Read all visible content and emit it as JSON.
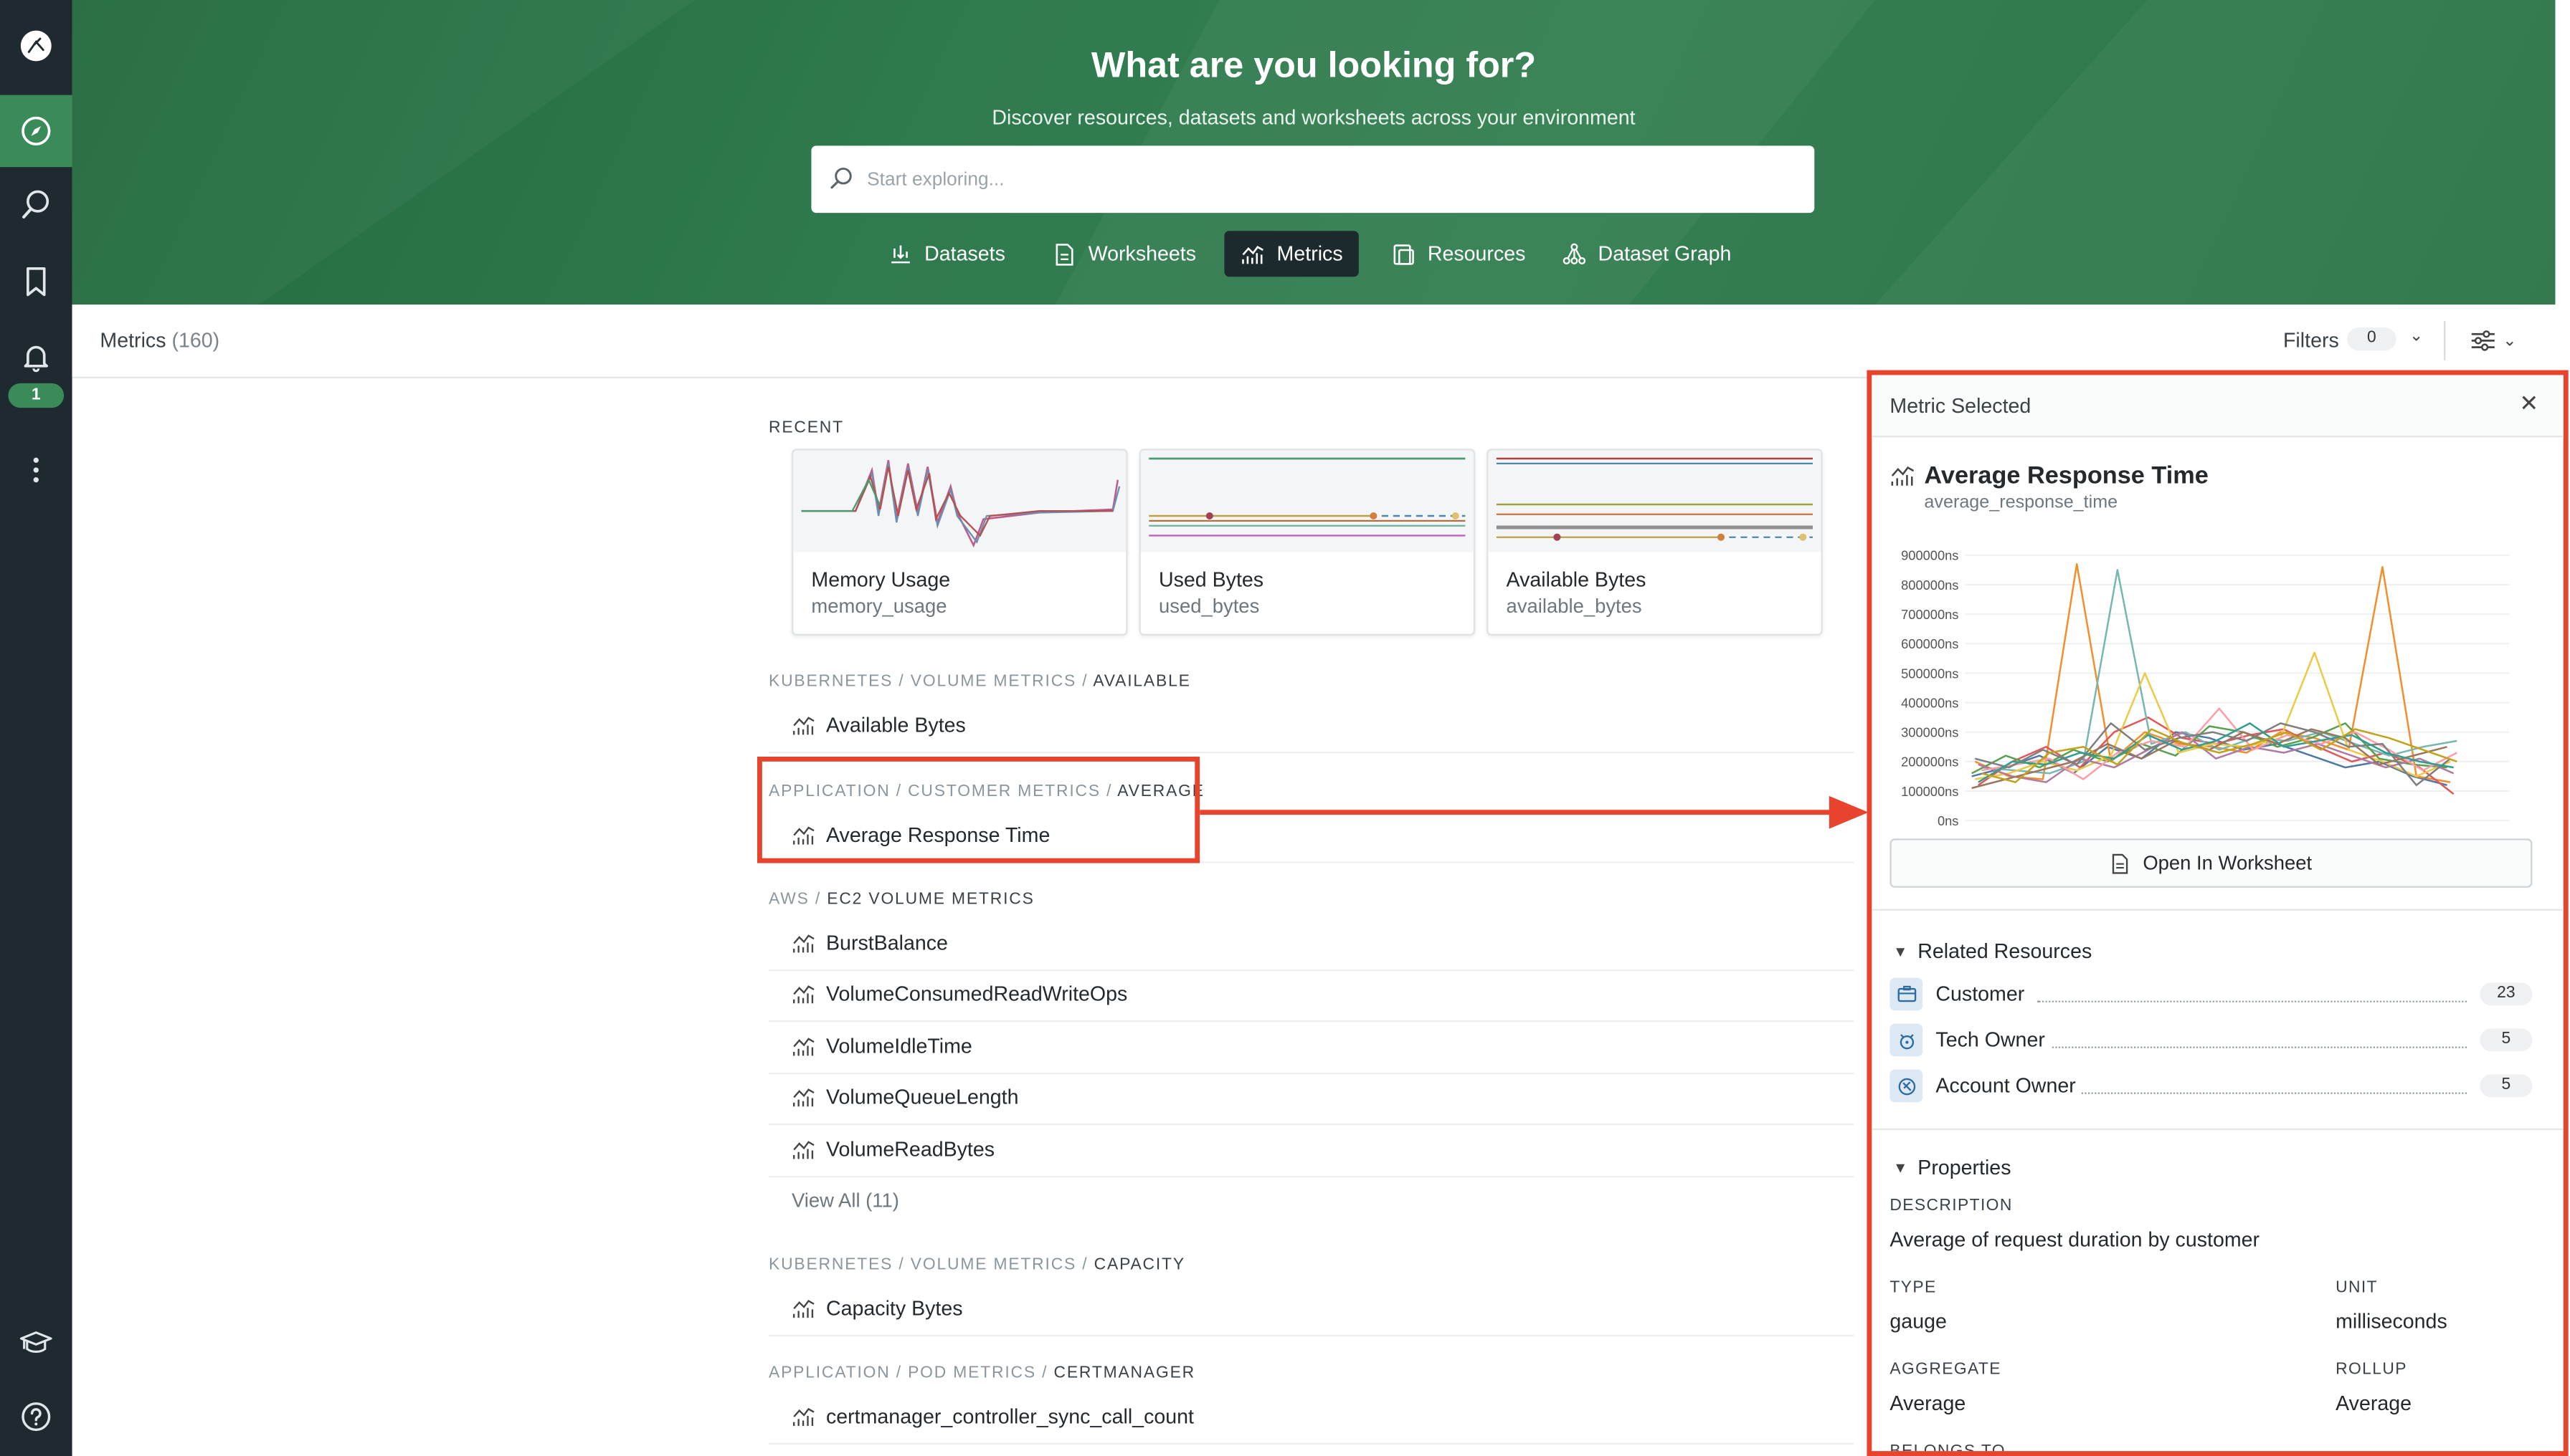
{
  "nav": {
    "badge": "1"
  },
  "hero": {
    "title": "What are you looking for?",
    "subtitle": "Discover resources, datasets and worksheets across your environment",
    "search_placeholder": "Start exploring...",
    "tabs": [
      {
        "label": "Datasets",
        "icon": "datasets-icon"
      },
      {
        "label": "Worksheets",
        "icon": "worksheet-icon"
      },
      {
        "label": "Metrics",
        "icon": "metrics-icon",
        "active": true
      },
      {
        "label": "Resources",
        "icon": "resources-icon"
      },
      {
        "label": "Dataset Graph",
        "icon": "graph-icon"
      }
    ]
  },
  "toolbar": {
    "title": "Metrics",
    "count": "(160)",
    "filters_label": "Filters",
    "filters_count": "0"
  },
  "recent": {
    "label": "RECENT",
    "cards": [
      {
        "title": "Memory Usage",
        "subtitle": "memory_usage"
      },
      {
        "title": "Used Bytes",
        "subtitle": "used_bytes"
      },
      {
        "title": "Available Bytes",
        "subtitle": "available_bytes"
      }
    ]
  },
  "sections": [
    {
      "path": "KUBERNETES / VOLUME METRICS / ",
      "last": "AVAILABLE",
      "items": [
        "Available Bytes"
      ]
    },
    {
      "path": "APPLICATION / CUSTOMER METRICS / ",
      "last": "AVERAGE",
      "items": [
        "Average Response Time"
      ]
    },
    {
      "path": "AWS / ",
      "last": "EC2 VOLUME METRICS",
      "items": [
        "BurstBalance",
        "VolumeConsumedReadWriteOps",
        "VolumeIdleTime",
        "VolumeQueueLength",
        "VolumeReadBytes"
      ],
      "view_all": "View All (11)"
    },
    {
      "path": "KUBERNETES / VOLUME METRICS / ",
      "last": "CAPACITY",
      "items": [
        "Capacity Bytes"
      ]
    },
    {
      "path": "APPLICATION / POD METRICS / ",
      "last": "CERTMANAGER",
      "items": [
        "certmanager_controller_sync_call_count"
      ]
    }
  ],
  "panel": {
    "header": "Metric Selected",
    "metric_name": "Average Response Time",
    "metric_id": "average_response_time",
    "open_button": "Open In Worksheet",
    "related_title": "Related Resources",
    "related": [
      {
        "name": "Customer",
        "count": "23",
        "icon": "customer-icon"
      },
      {
        "name": "Tech Owner",
        "count": "5",
        "icon": "tech-owner-icon"
      },
      {
        "name": "Account Owner",
        "count": "5",
        "icon": "account-owner-icon"
      }
    ],
    "properties_title": "Properties",
    "description_label": "DESCRIPTION",
    "description": "Average of request duration by customer",
    "type_label": "TYPE",
    "type": "gauge",
    "unit_label": "UNIT",
    "unit": "milliseconds",
    "aggregate_label": "AGGREGATE",
    "aggregate": "Average",
    "rollup_label": "ROLLUP",
    "rollup": "Average",
    "belongs_label": "BELONGS TO"
  },
  "chart_data": {
    "type": "line",
    "title": "",
    "y_tick_labels": [
      "0ns",
      "100000ns",
      "200000ns",
      "300000ns",
      "400000ns",
      "500000ns",
      "600000ns",
      "700000ns",
      "800000ns",
      "900000ns"
    ],
    "ylim": [
      0,
      900000
    ],
    "grid": true,
    "legend": "none",
    "series_colors": [
      "#4e79a7",
      "#f28e2b",
      "#e15759",
      "#76b7b2",
      "#59a14f",
      "#edc948",
      "#b07aa1",
      "#ff9da7",
      "#9c755f",
      "#7f7f7f",
      "#2f9e8f",
      "#c1a21c"
    ],
    "series": [
      {
        "values": [
          150000,
          180000,
          220000,
          160000,
          250000,
          210000,
          300000,
          280000,
          240000,
          260000,
          220000,
          180000,
          200000,
          150000,
          120000
        ]
      },
      {
        "values": [
          200000,
          150000,
          140000,
          870000,
          200000,
          300000,
          260000,
          250000,
          230000,
          300000,
          280000,
          240000,
          860000,
          150000,
          130000
        ]
      },
      {
        "values": [
          120000,
          200000,
          250000,
          180000,
          300000,
          350000,
          280000,
          260000,
          290000,
          310000,
          250000,
          200000,
          230000,
          180000,
          90000
        ]
      },
      {
        "values": [
          180000,
          170000,
          160000,
          200000,
          850000,
          260000,
          300000,
          240000,
          280000,
          270000,
          300000,
          260000,
          220000,
          250000,
          270000
        ]
      },
      {
        "values": [
          160000,
          220000,
          180000,
          240000,
          200000,
          260000,
          220000,
          320000,
          300000,
          250000,
          280000,
          330000,
          210000,
          190000,
          180000
        ]
      },
      {
        "values": [
          140000,
          160000,
          200000,
          170000,
          220000,
          500000,
          230000,
          260000,
          250000,
          280000,
          570000,
          240000,
          200000,
          150000,
          200000
        ]
      },
      {
        "values": [
          190000,
          150000,
          130000,
          210000,
          180000,
          240000,
          300000,
          210000,
          250000,
          230000,
          260000,
          220000,
          180000,
          210000,
          160000
        ]
      },
      {
        "values": [
          170000,
          190000,
          210000,
          140000,
          230000,
          270000,
          250000,
          380000,
          240000,
          290000,
          260000,
          300000,
          240000,
          170000,
          230000
        ]
      },
      {
        "values": [
          110000,
          140000,
          170000,
          200000,
          260000,
          210000,
          270000,
          240000,
          300000,
          260000,
          310000,
          280000,
          190000,
          220000,
          250000
        ]
      },
      {
        "values": [
          210000,
          180000,
          240000,
          190000,
          330000,
          240000,
          280000,
          300000,
          270000,
          330000,
          300000,
          250000,
          260000,
          120000,
          210000
        ]
      },
      {
        "values": [
          130000,
          200000,
          190000,
          230000,
          210000,
          290000,
          240000,
          270000,
          330000,
          250000,
          270000,
          290000,
          230000,
          200000,
          180000
        ]
      },
      {
        "values": [
          160000,
          130000,
          230000,
          250000,
          190000,
          310000,
          260000,
          230000,
          260000,
          300000,
          240000,
          310000,
          280000,
          240000,
          200000
        ]
      }
    ]
  }
}
